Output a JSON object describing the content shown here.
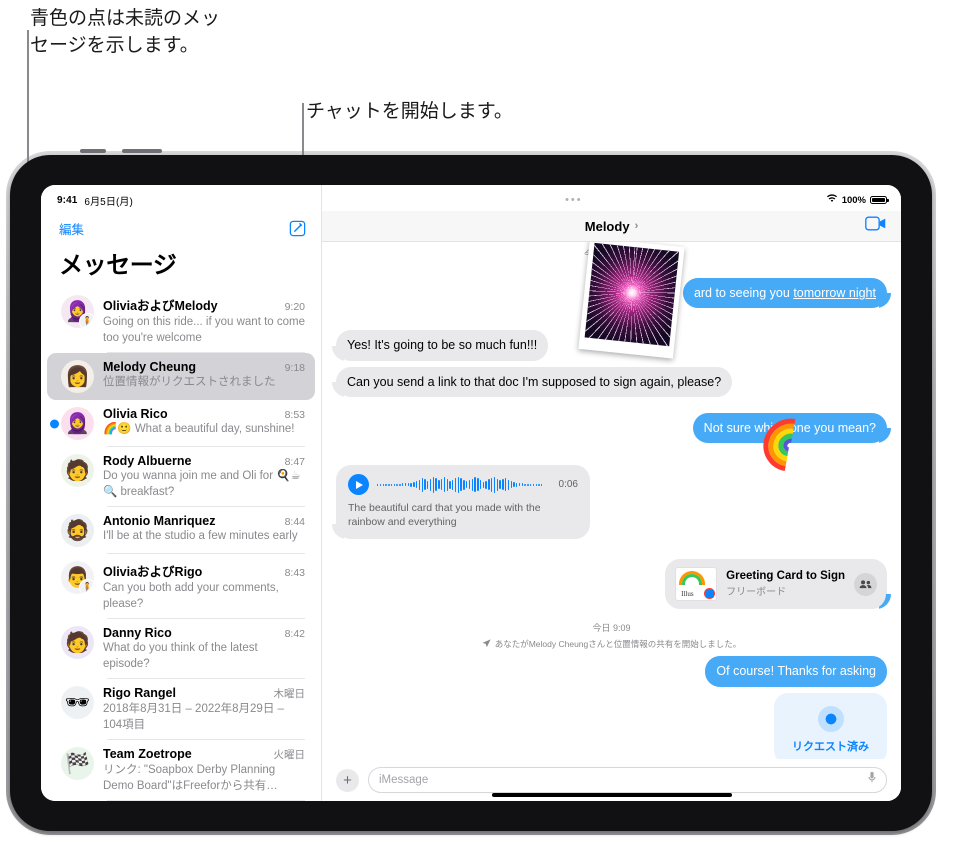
{
  "callouts": [
    {
      "id": "unread-dot-callout",
      "text": "青色の点は未読のメッ\nセージを示します。"
    },
    {
      "id": "compose-callout",
      "text": "チャットを開始します。"
    }
  ],
  "sidebar": {
    "status": {
      "time": "9:41",
      "date": "6月5日(月)"
    },
    "edit_label": "編集",
    "compose_icon": "compose-icon",
    "title": "メッセージ",
    "conversations": [
      {
        "name": "OliviaおよびMelody",
        "time": "9:20",
        "preview": "Going on this ride... if you want to come too you're welcome",
        "avatar": "🧕",
        "badge": "🧍",
        "unread": false,
        "selected": false,
        "bg": "#f6e8f2"
      },
      {
        "name": "Melody Cheung",
        "time": "9:18",
        "preview": "位置情報がリクエストされました",
        "avatar": "👩",
        "badge": "",
        "unread": false,
        "selected": true,
        "bg": "#f3efe8"
      },
      {
        "name": "Olivia Rico",
        "time": "8:53",
        "preview": "🌈🙂 What a beautiful day, sunshine!",
        "avatar": "🧕",
        "badge": "",
        "unread": true,
        "selected": false,
        "bg": "#fbdfee"
      },
      {
        "name": "Rody Albuerne",
        "time": "8:47",
        "preview": "Do you wanna join me and Oli for 🍳☕🔍 breakfast?",
        "avatar": "🧑",
        "badge": "",
        "unread": false,
        "selected": false,
        "bg": "#eef3ea"
      },
      {
        "name": "Antonio Manriquez",
        "time": "8:44",
        "preview": "I'll be at the studio a few minutes early",
        "avatar": "🧔",
        "badge": "",
        "unread": false,
        "selected": false,
        "bg": "#eceff1"
      },
      {
        "name": "OliviaおよびRigo",
        "time": "8:43",
        "preview": "Can you both add your comments, please?",
        "avatar": "👨",
        "badge": "🧍",
        "unread": false,
        "selected": false,
        "bg": "#f2f2f4"
      },
      {
        "name": "Danny Rico",
        "time": "8:42",
        "preview": "What do you think of the latest episode?",
        "avatar": "🧑",
        "badge": "",
        "unread": false,
        "selected": false,
        "bg": "#ece6f7"
      },
      {
        "name": "Rigo Rangel",
        "time": "木曜日",
        "preview": "2018年8月31日 – 2022年8月29日 – 104項目",
        "avatar": "🕶",
        "badge": "",
        "unread": false,
        "selected": false,
        "bg": "#eef1f4"
      },
      {
        "name": "Team Zoetrope",
        "time": "火曜日",
        "preview": "リンク: \"Soapbox Derby Planning Demo Board\"はFreeforから共有…",
        "avatar": "🏁",
        "badge": "",
        "unread": false,
        "selected": false,
        "bg": "#e9f4ea"
      }
    ]
  },
  "chat": {
    "status": {
      "dots": "•••",
      "wifi": "wifi-icon",
      "battery": "100%"
    },
    "title": "Melody",
    "chevron": "›",
    "facetime_icon": "facetime-video-icon",
    "day_label": "今日",
    "messages": [
      {
        "type": "text",
        "side": "out",
        "text": "ard to seeing you ",
        "link": "tomorrow night"
      },
      {
        "type": "text",
        "side": "in",
        "text": "Yes! It's going to be so much fun!!!"
      },
      {
        "type": "text",
        "side": "in",
        "text": "Can you send a link to that doc I'm supposed to sign again, please?"
      },
      {
        "type": "text",
        "side": "out",
        "text": "Not sure which one you mean?"
      },
      {
        "type": "audio",
        "side": "in",
        "duration": "0:06",
        "transcript": "The beautiful card that you made with the rainbow and everything"
      },
      {
        "type": "card",
        "side": "out",
        "title": "Greeting Card to Sign",
        "subtitle": "フリーボード",
        "people_icon": "people-icon"
      },
      {
        "type": "system",
        "timestamp": "今日 9:09",
        "text": "あなたがMelody Cheungさんと位置情報の共有を開始しました。",
        "icon": "location-arrow-icon"
      },
      {
        "type": "text",
        "side": "out",
        "text": "Of course! Thanks for asking"
      },
      {
        "type": "location",
        "side": "out",
        "label": "リクエスト済み"
      }
    ],
    "composer": {
      "plus_icon": "plus-icon",
      "placeholder": "iMessage",
      "mic_icon": "microphone-icon",
      "value": ""
    }
  },
  "colors": {
    "accent": "#0a84ff",
    "bubble_out": "#46aaf7",
    "bubble_in": "#e9e9eb",
    "selected_row": "#d2d2d7"
  }
}
